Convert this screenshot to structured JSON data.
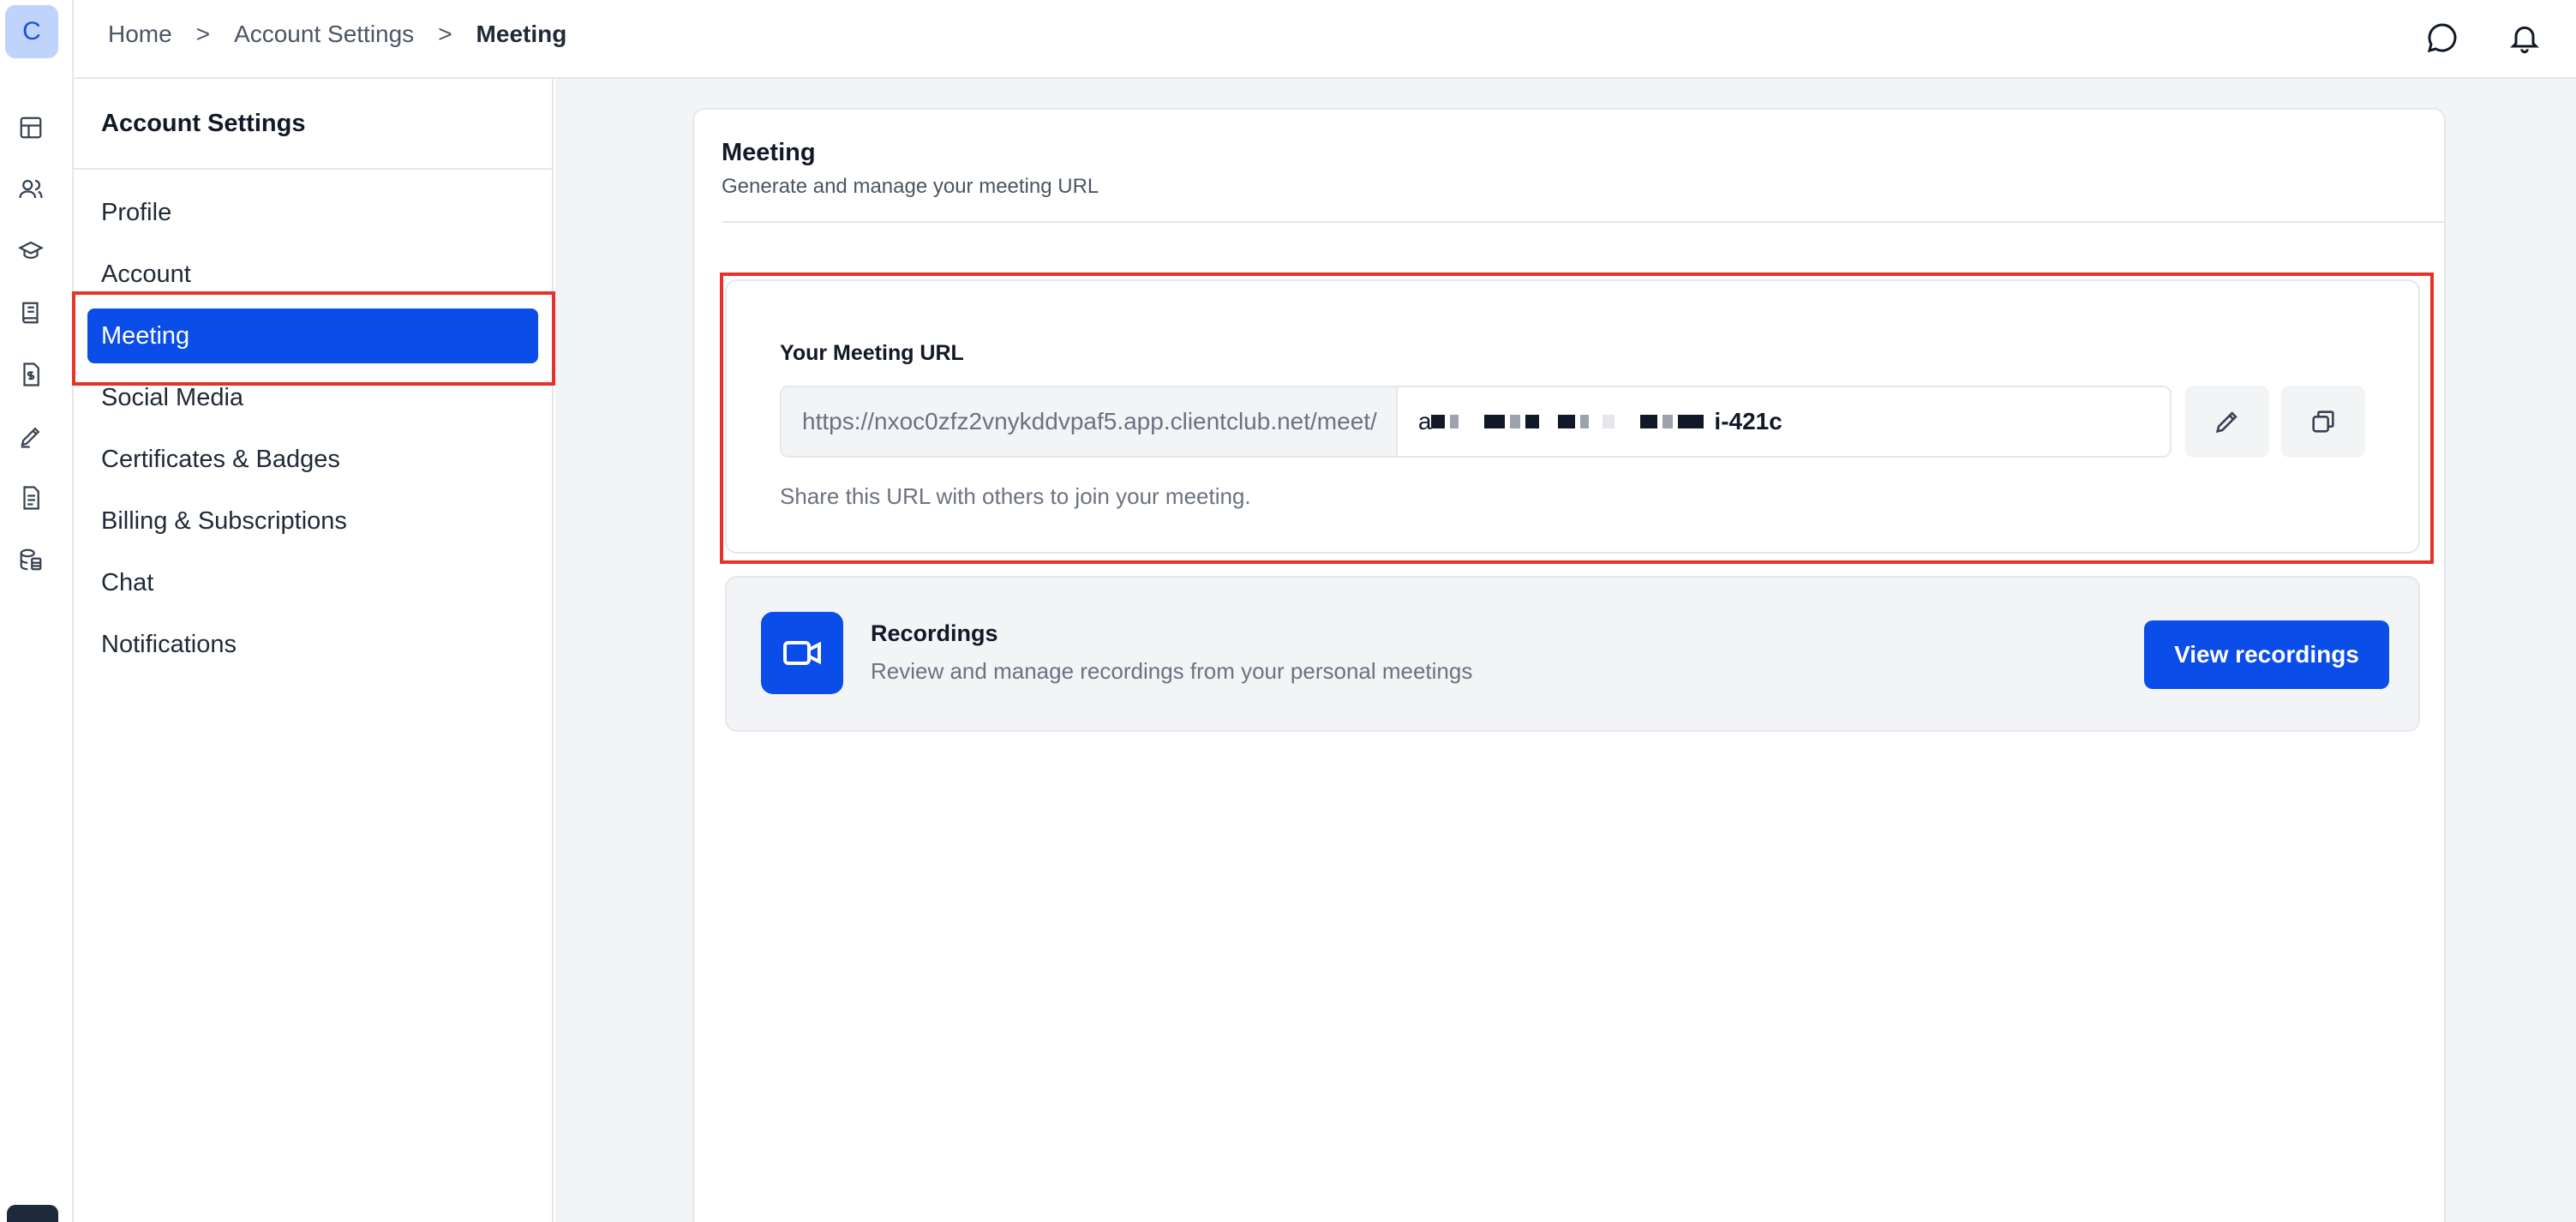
{
  "rail": {
    "avatar_letter": "C",
    "icons": [
      "dashboard-icon",
      "users-icon",
      "graduation-cap-icon",
      "book-icon",
      "file-dollar-icon",
      "pen-icon",
      "document-icon",
      "database-icon"
    ]
  },
  "breadcrumb": {
    "items": [
      "Home",
      "Account Settings",
      "Meeting"
    ],
    "separator": ">"
  },
  "topbar_icons": [
    "chat-icon",
    "bell-icon"
  ],
  "sidebar": {
    "title": "Account Settings",
    "items": [
      {
        "label": "Profile"
      },
      {
        "label": "Account"
      },
      {
        "label": "Meeting",
        "active": true
      },
      {
        "label": "Social Media"
      },
      {
        "label": "Certificates & Badges"
      },
      {
        "label": "Billing & Subscriptions"
      },
      {
        "label": "Chat"
      },
      {
        "label": "Notifications"
      }
    ]
  },
  "main": {
    "title": "Meeting",
    "subtitle": "Generate and manage your meeting URL",
    "url_section": {
      "label": "Your Meeting URL",
      "prefix": "https://nxoc0zfz2vnykddvpaf5.app.clientclub.net/meet/",
      "slug_visible_start": "a",
      "slug_visible_end": "i-421c",
      "help": "Share this URL with others to join your meeting."
    },
    "recordings": {
      "title": "Recordings",
      "subtitle": "Review and manage recordings from your personal meetings",
      "button": "View recordings"
    }
  },
  "colors": {
    "accent": "#0b4de8",
    "highlight": "#e5332a",
    "background": "#f3f4f6"
  }
}
